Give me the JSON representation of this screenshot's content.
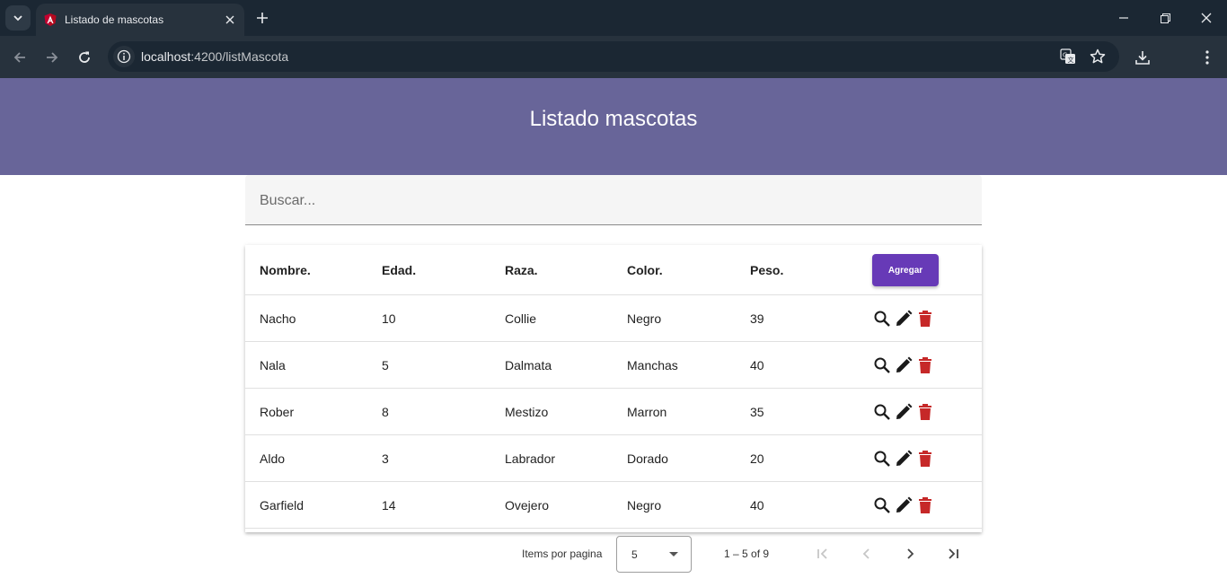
{
  "browser": {
    "tab_title": "Listado de mascotas",
    "url_host": "localhost",
    "url_path": ":4200/listMascota"
  },
  "header": {
    "title": "Listado mascotas"
  },
  "search": {
    "placeholder": "Buscar...",
    "value": ""
  },
  "table": {
    "columns": [
      "Nombre.",
      "Edad.",
      "Raza.",
      "Color.",
      "Peso."
    ],
    "add_label": "Agregar",
    "rows": [
      [
        "Nacho",
        "10",
        "Collie",
        "Negro",
        "39"
      ],
      [
        "Nala",
        "5",
        "Dalmata",
        "Manchas",
        "40"
      ],
      [
        "Rober",
        "8",
        "Mestizo",
        "Marron",
        "35"
      ],
      [
        "Aldo",
        "3",
        "Labrador",
        "Dorado",
        "20"
      ],
      [
        "Garfield",
        "14",
        "Ovejero",
        "Negro",
        "40"
      ]
    ]
  },
  "paginator": {
    "items_label": "Items por pagina",
    "page_size": "5",
    "range": "1 – 5 of 9"
  },
  "icons": {
    "view": "search-icon",
    "edit": "pencil-icon",
    "delete": "trash-icon"
  },
  "colors": {
    "header_bg": "#686599",
    "accent": "#673ab7",
    "delete": "#c62828"
  }
}
